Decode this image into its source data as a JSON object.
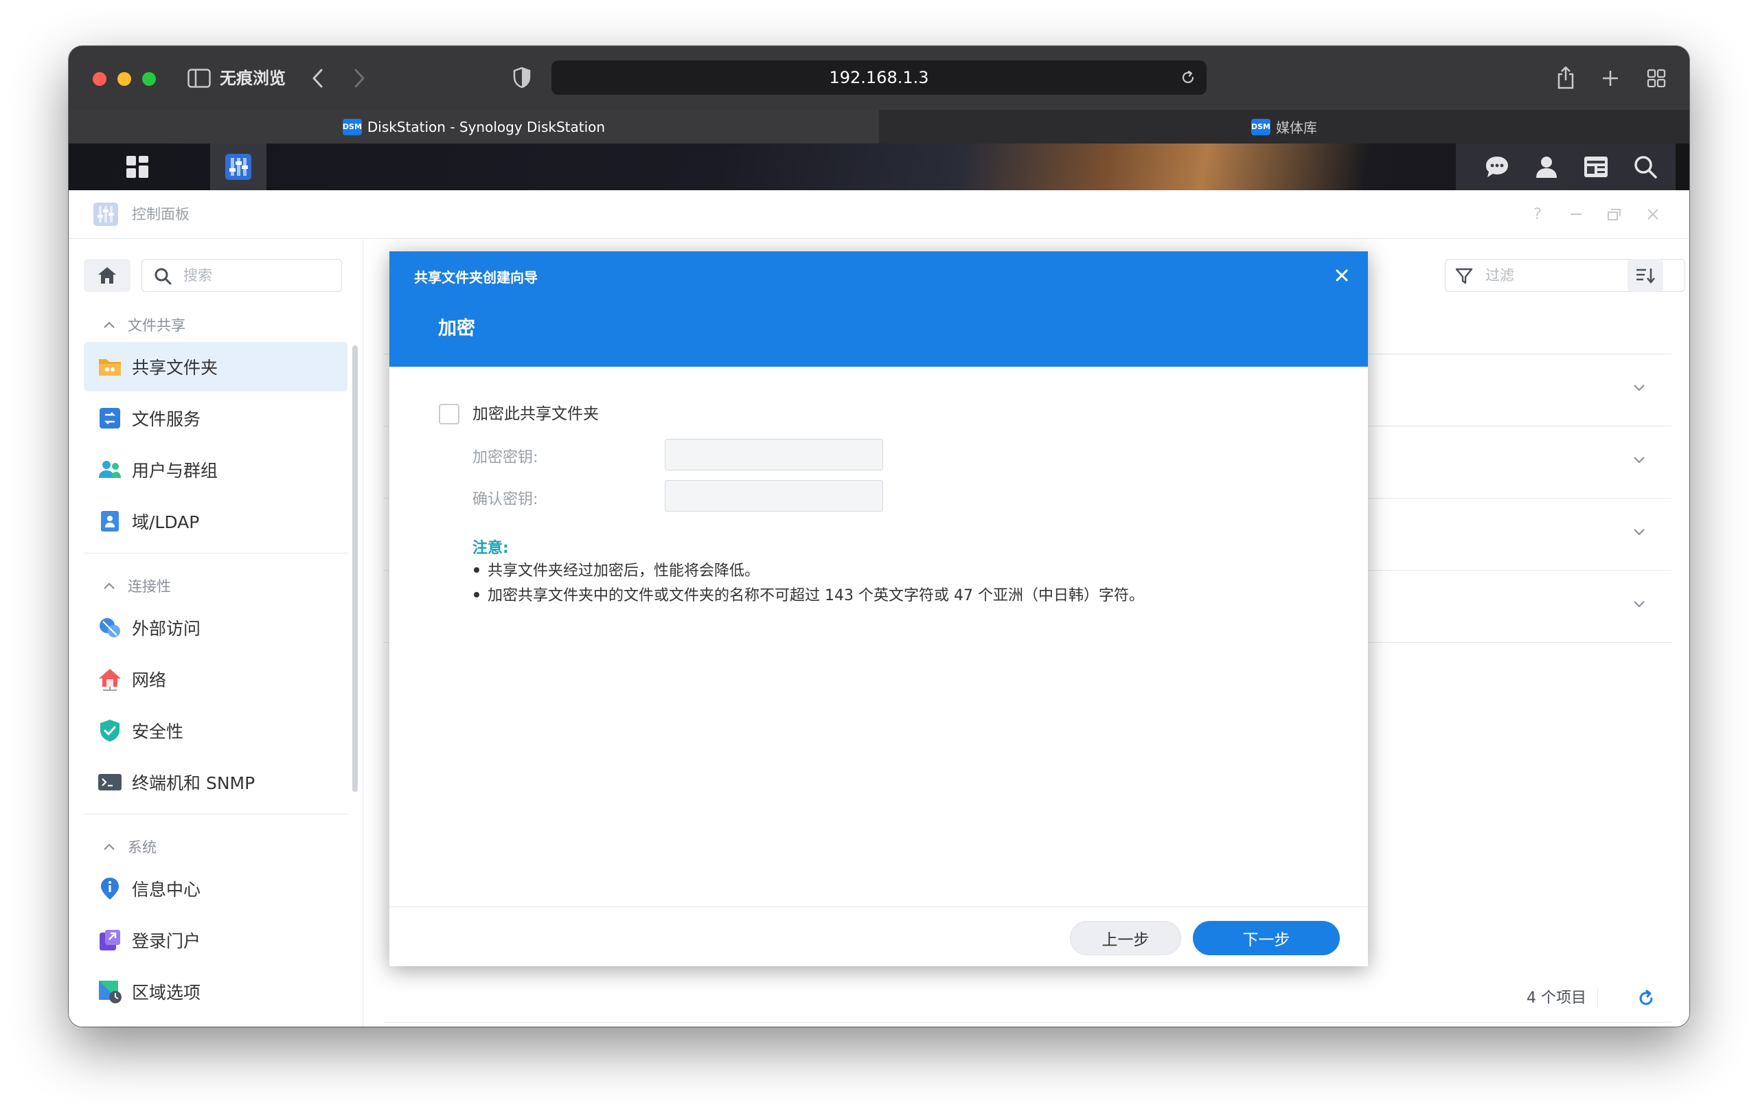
{
  "browser": {
    "privacy_label": "无痕浏览",
    "url": "192.168.1.3",
    "tabs": [
      {
        "icon_text": "DSM",
        "label": "DiskStation - Synology DiskStation"
      },
      {
        "icon_text": "DSM",
        "label": "媒体库"
      }
    ]
  },
  "control_panel": {
    "title": "控制面板",
    "search_placeholder": "搜索",
    "filter_placeholder": "过滤",
    "item_count": "4 个项目"
  },
  "sidebar": {
    "sections": [
      {
        "title": "文件共享",
        "items": [
          {
            "label": "共享文件夹",
            "icon": "shared-folder-icon",
            "selected": true
          },
          {
            "label": "文件服务",
            "icon": "file-services-icon"
          },
          {
            "label": "用户与群组",
            "icon": "users-groups-icon"
          },
          {
            "label": "域/LDAP",
            "icon": "domain-ldap-icon"
          }
        ]
      },
      {
        "title": "连接性",
        "items": [
          {
            "label": "外部访问",
            "icon": "external-access-icon"
          },
          {
            "label": "网络",
            "icon": "network-icon"
          },
          {
            "label": "安全性",
            "icon": "security-shield-icon"
          },
          {
            "label": "终端机和 SNMP",
            "icon": "terminal-icon"
          }
        ]
      },
      {
        "title": "系统",
        "items": [
          {
            "label": "信息中心",
            "icon": "info-center-icon"
          },
          {
            "label": "登录门户",
            "icon": "login-portal-icon"
          },
          {
            "label": "区域选项",
            "icon": "regional-options-icon"
          }
        ]
      }
    ]
  },
  "wizard": {
    "window_title": "共享文件夹创建向导",
    "step_title": "加密",
    "encrypt_checkbox_label": "加密此共享文件夹",
    "encrypt_checked": false,
    "key_label": "加密密钥:",
    "key_value": "",
    "confirm_label": "确认密钥:",
    "confirm_value": "",
    "note_title": "注意:",
    "notes": [
      "共享文件夹经过加密后，性能将会降低。",
      "加密共享文件夹中的文件或文件夹的名称不可超过 143 个英文字符或 47 个亚洲（中日韩）字符。"
    ],
    "back_label": "上一步",
    "next_label": "下一步"
  },
  "colors": {
    "accent": "#1a7fe4",
    "note_title": "#1aa3b8",
    "selected_bg": "#e6f0fb"
  }
}
